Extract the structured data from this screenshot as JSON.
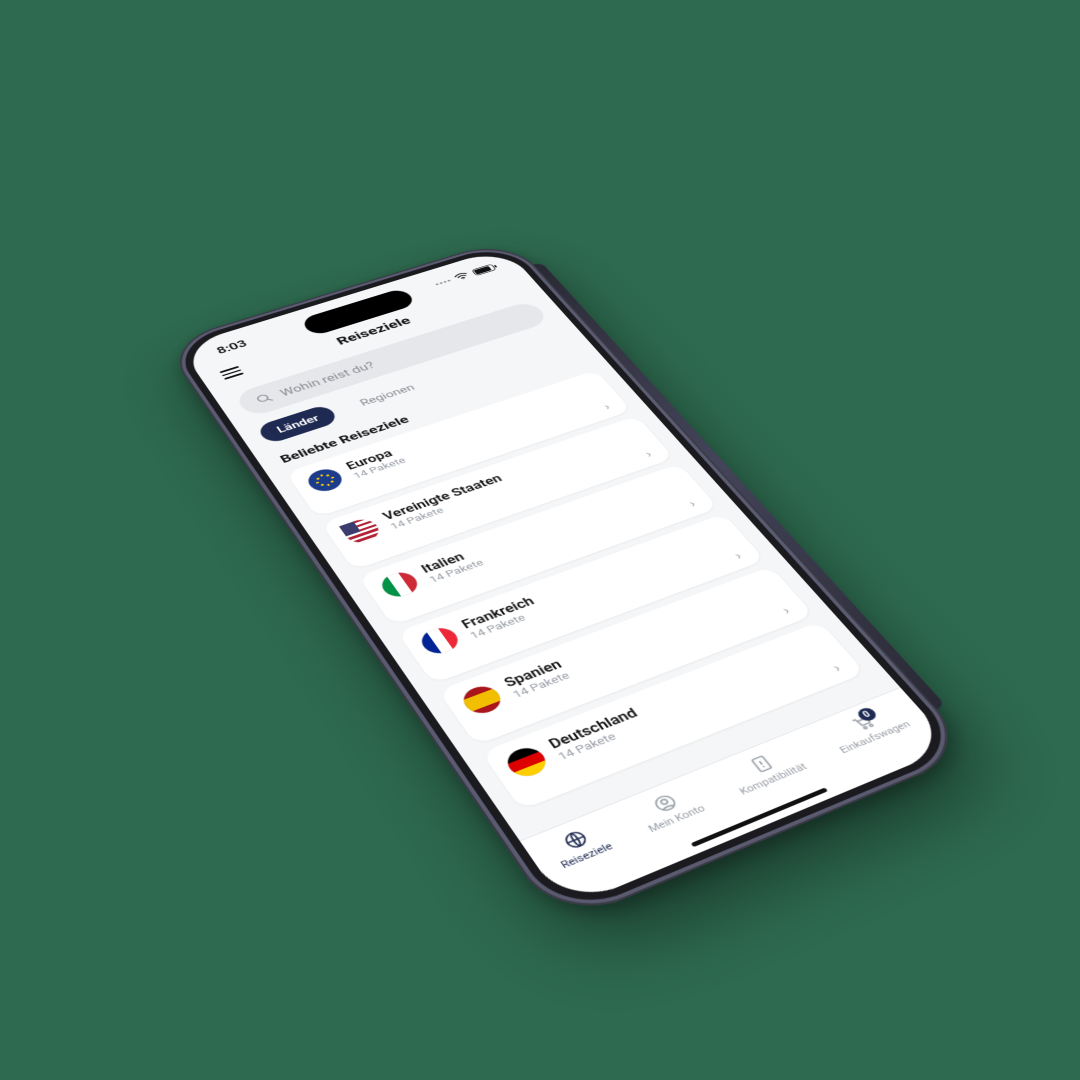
{
  "status": {
    "time": "8:03"
  },
  "header": {
    "title": "Reiseziele"
  },
  "search": {
    "placeholder": "Wohin reist du?"
  },
  "tabs": {
    "active": "Länder",
    "inactive": "Regionen"
  },
  "section": {
    "title": "Beliebte Reiseziele"
  },
  "destinations": [
    {
      "name": "Europa",
      "sub": "14 Pakete",
      "flag": "eu"
    },
    {
      "name": "Vereinigte Staaten",
      "sub": "14 Pakete",
      "flag": "us"
    },
    {
      "name": "Italien",
      "sub": "14 Pakete",
      "flag": "it"
    },
    {
      "name": "Frankreich",
      "sub": "14 Pakete",
      "flag": "fr"
    },
    {
      "name": "Spanien",
      "sub": "14 Pakete",
      "flag": "es"
    },
    {
      "name": "Deutschland",
      "sub": "14 Pakete",
      "flag": "de"
    }
  ],
  "nav": {
    "destinations": "Reiseziele",
    "account": "Mein Konto",
    "compat": "Kompatibilität",
    "cart": "Einkaufswagen",
    "cart_count": "0"
  }
}
